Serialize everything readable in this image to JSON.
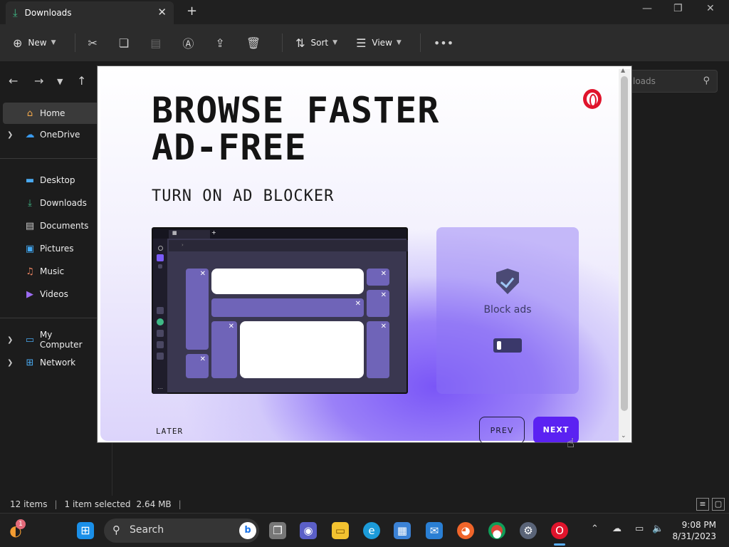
{
  "titlebar": {
    "tab_title": "Downloads"
  },
  "toolbar": {
    "new_label": "New",
    "sort_label": "Sort",
    "view_label": "View"
  },
  "search": {
    "placeholder_visible": "loads"
  },
  "sidebar": {
    "items": [
      {
        "label": "Home",
        "icon": "home-icon"
      },
      {
        "label": "OneDrive",
        "icon": "cloud-icon"
      },
      {
        "label": "Desktop",
        "icon": "desktop-icon"
      },
      {
        "label": "Downloads",
        "icon": "download-icon"
      },
      {
        "label": "Documents",
        "icon": "document-icon"
      },
      {
        "label": "Pictures",
        "icon": "picture-icon"
      },
      {
        "label": "Music",
        "icon": "music-icon"
      },
      {
        "label": "Videos",
        "icon": "video-icon"
      },
      {
        "label": "My Computer",
        "icon": "computer-icon"
      },
      {
        "label": "Network",
        "icon": "network-icon"
      }
    ]
  },
  "status": {
    "items": "12 items",
    "selected": "1 item selected",
    "size": "2.64 MB"
  },
  "modal": {
    "headline_line1": "BROWSE FASTER",
    "headline_line2": "AD-FREE",
    "subhead": "TURN ON AD BLOCKER",
    "card_label": "Block ads",
    "later": "LATER",
    "prev": "PREV",
    "next": "NEXT",
    "accent": "#5b22f2"
  },
  "taskbar": {
    "search_label": "Search",
    "notification_count": "1",
    "time": "9:08 PM",
    "date": "8/31/2023"
  }
}
